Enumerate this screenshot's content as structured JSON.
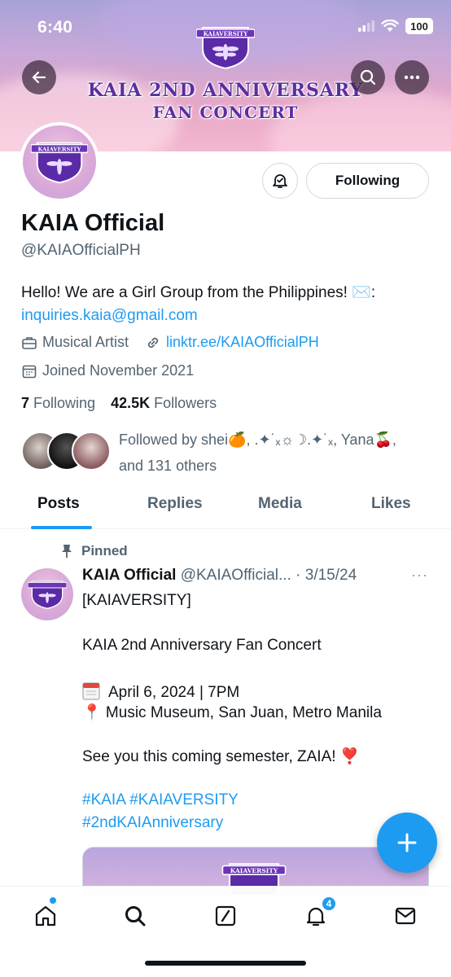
{
  "status_bar": {
    "time": "6:40",
    "battery": "100"
  },
  "banner": {
    "crest_text": "KAIAVERSITY",
    "title_line1": "KAIA 2ND ANNIVERSARY",
    "title_line2": "FAN CONCERT"
  },
  "header_buttons": {
    "back_icon": "back-arrow-icon",
    "search_icon": "search-icon",
    "more_icon": "more-icon"
  },
  "profile": {
    "display_name": "KAIA Official",
    "handle": "@KAIAOfficialPH",
    "following_label": "Following",
    "bio_text": "Hello! We are a Girl Group from the Philippines! ✉️:",
    "bio_link": "inquiries.kaia@gmail.com",
    "category": "Musical Artist",
    "website": "linktr.ee/KAIAOfficialPH",
    "joined": "Joined November 2021",
    "following_count": "7",
    "following_word": "Following",
    "followers_count": "42.5K",
    "followers_word": "Followers",
    "followed_by_line1": "Followed by shei🍊, .✦˙ₓ☼☽.✦˙ₓ, Yana🍒,",
    "followed_by_line2": "and 131 others"
  },
  "tabs": [
    {
      "label": "Posts",
      "active": true
    },
    {
      "label": "Replies",
      "active": false
    },
    {
      "label": "Media",
      "active": false
    },
    {
      "label": "Likes",
      "active": false
    }
  ],
  "post": {
    "pinned_label": "Pinned",
    "author_name": "KAIA Official",
    "author_handle": "@KAIAOfficial...",
    "date": "· 3/15/24",
    "more": "···",
    "line1": "[KAIAVERSITY]",
    "line2": "KAIA 2nd Anniversary Fan Concert",
    "line3": "April 6, 2024 | 7PM",
    "line4": "📍 Music Museum, San Juan, Metro Manila",
    "line5": "See you this coming semester, ZAIA! ❣️",
    "hashtags1": "#KAIA #KAIAVERSITY",
    "hashtags2": "#2ndKAIAnniversary",
    "image_crest_text": "KAIAVERSITY"
  },
  "bottom_nav": {
    "notification_badge": "4"
  },
  "colors": {
    "accent": "#1d9bf0",
    "text": "#0f1419",
    "muted": "#536471"
  }
}
